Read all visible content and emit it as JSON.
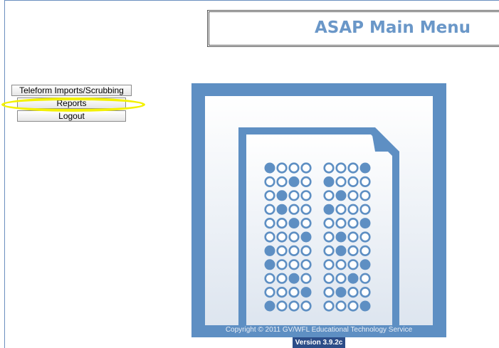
{
  "header": {
    "title": "ASAP Main Menu"
  },
  "menu": {
    "teleform_label": "Teleform Imports/Scrubbing",
    "reports_label": "Reports",
    "logout_label": "Logout"
  },
  "footer": {
    "copyright": "Copyright © 2011 GV/WFL Educational Technology Service",
    "version": "Version 3.9.2c"
  },
  "logo": {
    "icon": "answer-sheet-logo",
    "bubble_rows": [
      [
        1,
        0,
        0,
        0,
        0,
        0,
        0,
        1
      ],
      [
        0,
        0,
        1,
        0,
        1,
        0,
        0,
        0
      ],
      [
        0,
        1,
        0,
        0,
        0,
        1,
        0,
        0
      ],
      [
        0,
        1,
        0,
        0,
        1,
        0,
        0,
        0
      ],
      [
        0,
        0,
        1,
        0,
        0,
        0,
        0,
        1
      ],
      [
        0,
        0,
        0,
        1,
        0,
        1,
        0,
        0
      ],
      [
        1,
        0,
        0,
        0,
        0,
        1,
        0,
        0
      ],
      [
        1,
        0,
        0,
        0,
        0,
        0,
        0,
        1
      ],
      [
        0,
        0,
        1,
        0,
        0,
        0,
        1,
        0
      ],
      [
        0,
        0,
        0,
        1,
        0,
        1,
        0,
        0
      ],
      [
        1,
        0,
        0,
        0,
        0,
        0,
        0,
        1
      ]
    ]
  },
  "colors": {
    "accent": "#6a97c8",
    "logo_blue": "#5e8fc3",
    "version_bg": "#2c4d88",
    "highlight": "#f3f100"
  }
}
